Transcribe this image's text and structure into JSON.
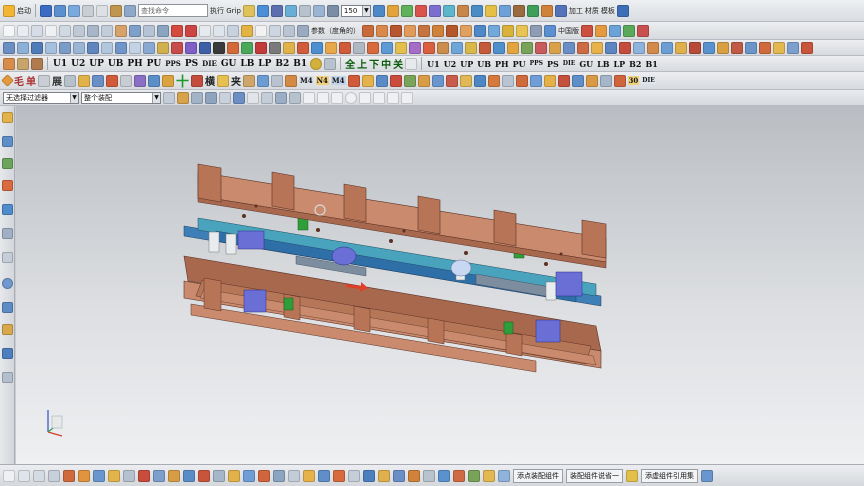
{
  "toolbar_top": {
    "start_label": "启动",
    "search_placeholder": "查找命令",
    "exec_label": "执行 Grip",
    "zoom_value": "150",
    "process_label": "加工",
    "material_label": "材质",
    "template_label": "模板",
    "menu_label": "菜单"
  },
  "toolbar_row2": {
    "params_label": "参数（度角的）",
    "china_label": "中国版"
  },
  "toolbar_row4": {
    "codes": [
      "U1",
      "U2",
      "UP",
      "UB",
      "PH",
      "PU",
      "PPS",
      "PS",
      "DIE",
      "GU",
      "LB",
      "LP",
      "B2",
      "B1"
    ],
    "chinese": [
      "全",
      "上",
      "下",
      "中",
      "关"
    ],
    "right_codes": [
      "U1",
      "U2",
      "UP",
      "UB",
      "PH",
      "PU",
      "PPS",
      "PS",
      "DIE",
      "GU",
      "LB",
      "LP",
      "B2",
      "B1"
    ]
  },
  "toolbar_row5": {
    "labels": [
      "毛",
      "单",
      "展",
      "十",
      "横",
      "夹"
    ],
    "codes": [
      "M4",
      "N4",
      "M4"
    ],
    "misc": [
      "30",
      "DIE"
    ]
  },
  "selection_bar": {
    "filter_value": "无选择过滤器",
    "assembly_value": "整个装配"
  },
  "bottom_bar": {
    "buttons": [
      "添点装配组件",
      "装配组件说省一",
      "添虚组件引用集"
    ]
  },
  "colors": {
    "die_plate": "#c98a6e",
    "plate_dark": "#a8684e",
    "insert_blue": "#3e7fb7",
    "insert_cyan": "#4aa3bd",
    "spring_purple": "#6a6fd6",
    "guide_green": "#2f9e3a",
    "pillar_white": "#e8ecee"
  }
}
